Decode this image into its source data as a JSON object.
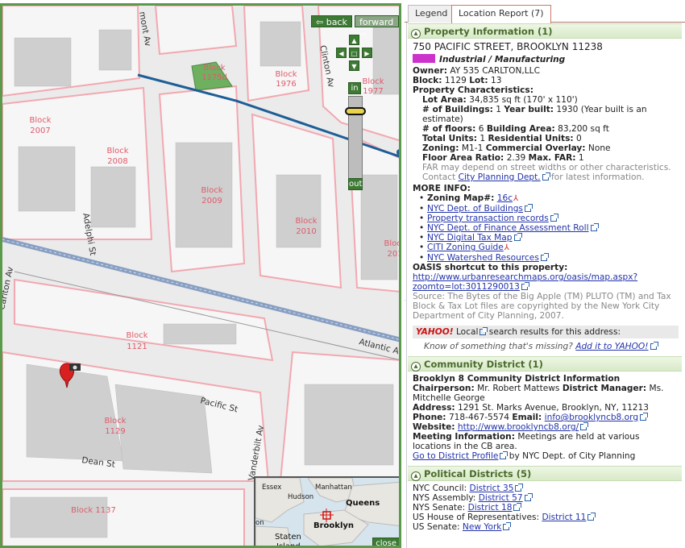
{
  "map": {
    "nav": {
      "back": "⇦ back",
      "forward": "forward ⇨"
    },
    "zoom": {
      "in": "in",
      "out": "out",
      "level": 0.15
    },
    "blocks": [
      "Block\n1175d",
      "Block\n1976",
      "Block\n1977",
      "Block\n2007",
      "Block\n2008",
      "Block\n2009",
      "Block\n2010",
      "Block\n201",
      "Block\n1121",
      "Block\n1129",
      "Block 1137"
    ],
    "streets": [
      "mont Av",
      "Clinton Av",
      "Adelphi St",
      "Carlton Av",
      "Atlantic Av",
      "Pacific St",
      "Dean St",
      "Vanderbilt Av"
    ],
    "minimap": {
      "places": [
        "Essex",
        "Hudson",
        "Manhattan",
        "Queens",
        "Brooklyn",
        "Staten Island",
        "on"
      ],
      "close": "close"
    }
  },
  "tabs": {
    "legend": "Legend",
    "report": "Location Report (7)"
  },
  "property": {
    "header": "Property Information (1)",
    "address": "750 PACIFIC STREET, BROOKLYN 11238",
    "landuse": "Industrial / Manufacturing",
    "landuse_color": "#cc33cc",
    "owner_label": "Owner:",
    "owner": "AY 535 CARLTON,LLC",
    "block_label": "Block:",
    "block": "1129",
    "lot_label": "Lot:",
    "lot": "13",
    "chars_label": "Property Characteristics:",
    "lot_area_label": "Lot Area:",
    "lot_area": "34,835 sq ft (170' x 110')",
    "buildings_label": "# of Buildings:",
    "buildings": "1",
    "year_label": "Year built:",
    "year": "1930 (Year built is an estimate)",
    "floors_label": "# of floors:",
    "floors": "6",
    "bldg_area_label": "Building Area:",
    "bldg_area": "83,200 sq ft",
    "units_label": "Total Units:",
    "units": "1",
    "res_units_label": "Residential Units:",
    "res_units": "0",
    "zoning_label": "Zoning:",
    "zoning": "M1-1",
    "overlay_label": "Commercial Overlay:",
    "overlay": "None",
    "far_label": "Floor Area Ratio:",
    "far": "2.39",
    "maxfar_label": "Max. FAR:",
    "maxfar": "1",
    "far_note": "FAR may depend on street widths or other characteristics. Contact",
    "far_link": "City Planning Dept.",
    "far_note2": "for latest information.",
    "more_info": "MORE INFO:",
    "zoning_map_label": "Zoning Map#:",
    "zoning_map": "16c",
    "links": [
      "NYC Dept. of Buildings",
      "Property transaction records",
      "NYC Dept. of Finance Assessment Roll",
      "NYC Digital Tax Map",
      "CITI Zoning Guide",
      "NYC Watershed Resources"
    ],
    "oasis_label": "OASIS shortcut to this property:",
    "oasis_url1": "http://www.urbanresearchmaps.org/oasis/map.aspx?",
    "oasis_url2": "zoomto=lot:3011290013",
    "source": "Source: The Bytes of the Big Apple (TM) PLUTO (TM) and Tax Block & Tax Lot files are copyrighted by the New York City Department of City Planning, 2007.",
    "yahoo": {
      "logo": "YAHOO!",
      "local": "Local",
      "text": "search results for this address:"
    },
    "missing": "Know of something that's missing?",
    "missing_link": "Add it to YAHOO!"
  },
  "community": {
    "header": "Community District (1)",
    "title": "Brooklyn 8 Community District Information",
    "chair_label": "Chairperson:",
    "chair": "Mr. Robert Mattews",
    "dm_label": "District Manager:",
    "dm": "Ms. Mitchelle George",
    "address_label": "Address:",
    "address": "1291 St. Marks Avenue, Brooklyn, NY, 11213",
    "phone_label": "Phone:",
    "phone": "718-467-5574",
    "email_label": "Email:",
    "email": "info@brooklyncb8.org",
    "website_label": "Website:",
    "website": "http://www.brooklyncb8.org/",
    "meeting_label": "Meeting Information:",
    "meeting": "Meetings are held at various locations in the CB area.",
    "profile_link": "Go to District Profile",
    "profile_by": "by NYC Dept. of City Planning"
  },
  "political": {
    "header": "Political Districts (5)",
    "rows": [
      {
        "label": "NYC Council:",
        "value": "District 35"
      },
      {
        "label": "NYS Assembly:",
        "value": "District 57"
      },
      {
        "label": "NYS Senate:",
        "value": "District 18"
      },
      {
        "label": "US House of Representatives:",
        "value": "District 11"
      },
      {
        "label": "US Senate:",
        "value": "New York"
      }
    ]
  }
}
